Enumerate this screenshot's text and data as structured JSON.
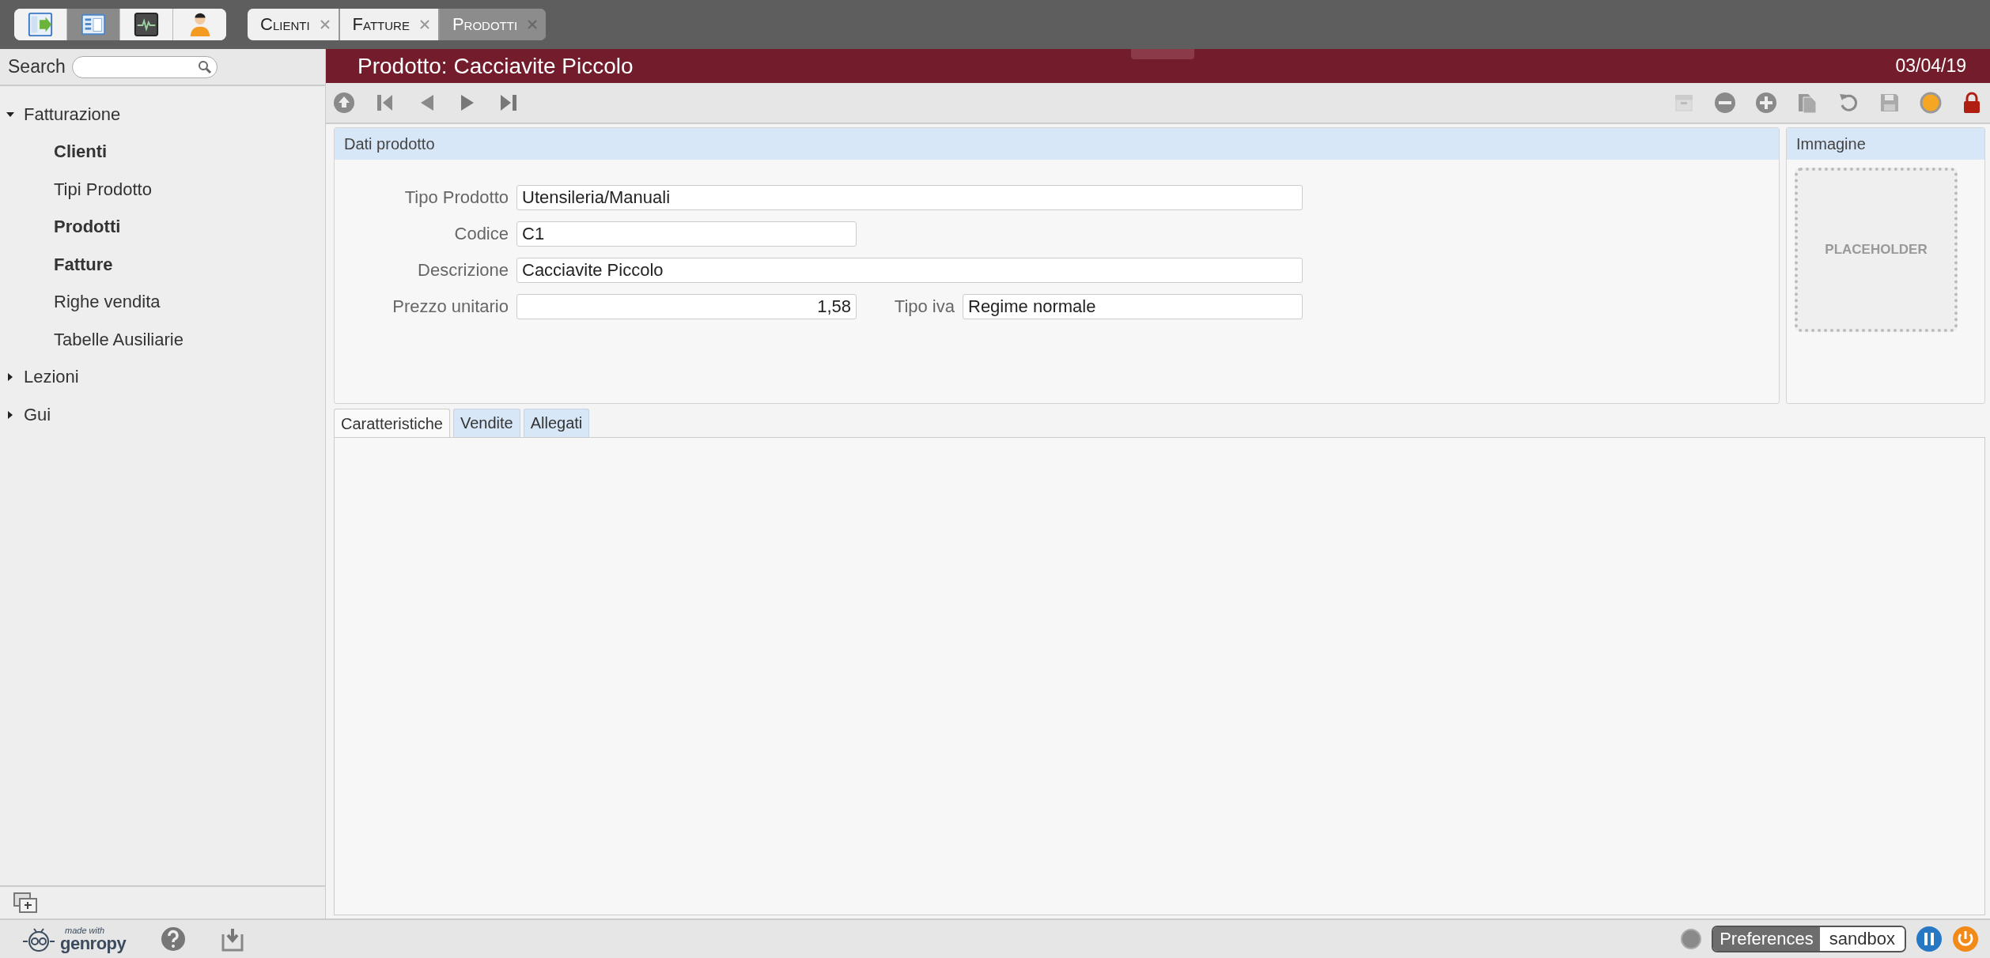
{
  "app_buttons": [
    {
      "kind": "panel",
      "selected": false
    },
    {
      "kind": "list",
      "selected": true
    },
    {
      "kind": "monitor",
      "selected": false
    },
    {
      "kind": "user",
      "selected": false
    }
  ],
  "page_tabs": [
    {
      "label": "Clienti",
      "selected": false
    },
    {
      "label": "Fatture",
      "selected": false
    },
    {
      "label": "Prodotti",
      "selected": true
    }
  ],
  "search": {
    "label": "Search"
  },
  "tree": [
    {
      "label": "Fatturazione",
      "expanded": true,
      "children": [
        {
          "label": "Clienti",
          "active": true
        },
        {
          "label": "Tipi Prodotto",
          "active": false
        },
        {
          "label": "Prodotti",
          "active": true
        },
        {
          "label": "Fatture",
          "active": true
        },
        {
          "label": "Righe vendita",
          "active": false
        },
        {
          "label": "Tabelle Ausiliarie",
          "active": false
        }
      ]
    },
    {
      "label": "Lezioni",
      "expanded": false
    },
    {
      "label": "Gui",
      "expanded": false
    }
  ],
  "record": {
    "title": "Prodotto: Cacciavite Piccolo",
    "date": "03/04/19"
  },
  "form": {
    "title": "Dati prodotto",
    "rows": [
      {
        "fields": [
          {
            "label": "Tipo Prodotto",
            "value": "Utensileria/Manuali",
            "kind": "wide"
          }
        ]
      },
      {
        "fields": [
          {
            "label": "Codice",
            "value": "C1",
            "kind": "text"
          }
        ]
      },
      {
        "fields": [
          {
            "label": "Descrizione",
            "value": "Cacciavite Piccolo",
            "kind": "wide"
          }
        ]
      },
      {
        "fields": [
          {
            "label": "Prezzo unitario",
            "value": "1,58",
            "kind": "number"
          },
          {
            "label": "Tipo iva",
            "value": "Regime normale",
            "kind": "text"
          }
        ]
      }
    ]
  },
  "image_panel": {
    "title": "Immagine",
    "placeholder": "PLACEHOLDER"
  },
  "detail_tabs": [
    {
      "label": "Caratteristiche",
      "selected": true
    },
    {
      "label": "Vendite",
      "selected": false
    },
    {
      "label": "Allegati",
      "selected": false
    }
  ],
  "status_bar": {
    "made_with": "made with",
    "brand": "genropy",
    "preferences": "Preferences",
    "environment": "sandbox"
  }
}
